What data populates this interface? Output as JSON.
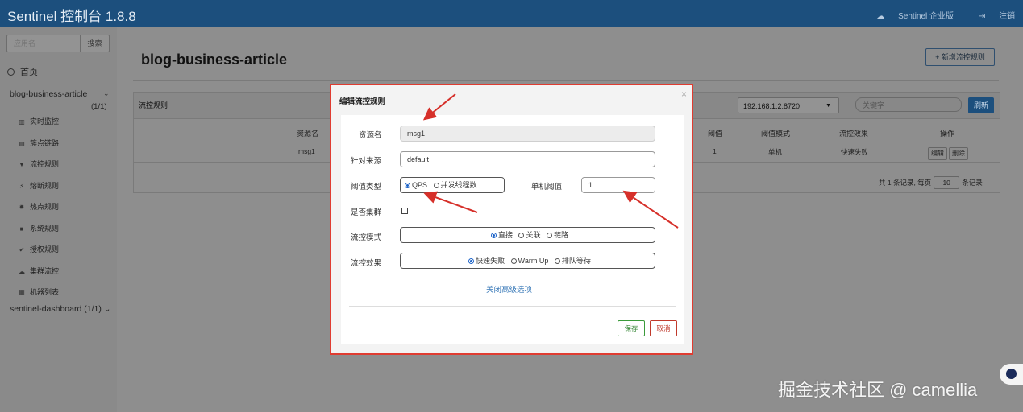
{
  "navbar": {
    "brand": "Sentinel 控制台 1.8.8",
    "enterprise": "Sentinel 企业版",
    "logout": "注销"
  },
  "sidebar": {
    "search_placeholder": "应用名",
    "search_button": "搜索",
    "home": "首页",
    "app_name": "blog-business-article",
    "app_count": "(1/1)",
    "menu": [
      "实时监控",
      "簇点链路",
      "流控规则",
      "熔断规则",
      "热点规则",
      "系统规则",
      "授权规则",
      "集群流控",
      "机器列表"
    ],
    "menu_icons": [
      "chart-icon",
      "list-icon",
      "filter-icon",
      "bolt-icon",
      "fire-icon",
      "lock-icon",
      "check-icon",
      "cloud-icon",
      "table-icon"
    ],
    "app2": "sentinel-dashboard (1/1)"
  },
  "main": {
    "title": "blog-business-article",
    "add_button": "+ 新增流控规则",
    "panel_title": "流控规则",
    "ip_select": "192.168.1.2:8720",
    "keyword_placeholder": "关键字",
    "refresh": "刷新",
    "headers": [
      "资源名",
      "阈值",
      "阈值模式",
      "流控效果",
      "操作"
    ],
    "row": [
      "msg1",
      "1",
      "单机",
      "快速失败"
    ],
    "edit": "编辑",
    "delete": "删除",
    "pager_prefix": "共 1 条记录, 每页",
    "pager_size": "10",
    "pager_suffix": "条记录"
  },
  "modal": {
    "title": "编辑流控规则",
    "close": "×",
    "resource_label": "资源名",
    "resource_value": "msg1",
    "source_label": "针对来源",
    "source_value": "default",
    "threshold_type_label": "阈值类型",
    "qps": "QPS",
    "threads": "并发线程数",
    "single_threshold_label": "单机阈值",
    "single_threshold_value": "1",
    "cluster_label": "是否集群",
    "mode_label": "流控模式",
    "mode_direct": "直接",
    "mode_assoc": "关联",
    "mode_chain": "链路",
    "effect_label": "流控效果",
    "effect_fast": "快速失败",
    "effect_warm": "Warm Up",
    "effect_queue": "排队等待",
    "advanced": "关闭高级选项",
    "save": "保存",
    "cancel": "取消"
  },
  "watermark": "掘金技术社区 @ camellia",
  "colors": {
    "navbar": "#1c4f7d",
    "highlight": "#e03c31",
    "radio": "#1e64c8"
  }
}
